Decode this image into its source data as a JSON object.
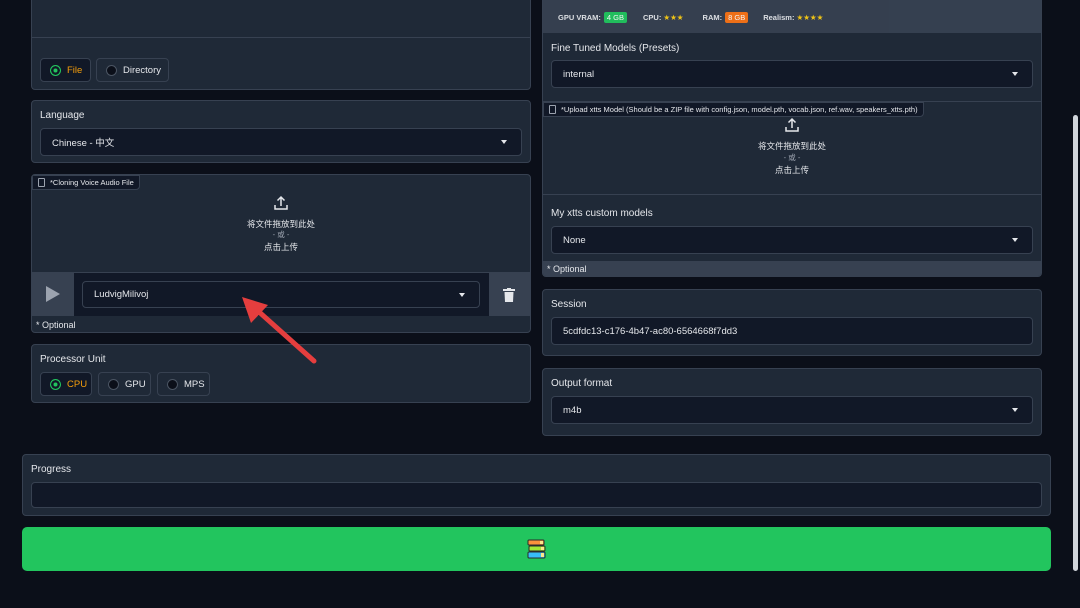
{
  "left": {
    "input_type": {
      "options": [
        "File",
        "Directory"
      ],
      "selected": "File"
    },
    "language": {
      "label": "Language",
      "value": "Chinese - 中文"
    },
    "voice_upload": {
      "tag": "*Cloning Voice Audio File",
      "drop_text": "将文件拖放到此处",
      "or_text": "- 或 -",
      "click_text": "点击上传"
    },
    "voice_select": {
      "value": "LudvigMilivoj",
      "optional": "* Optional"
    },
    "processor": {
      "label": "Processor Unit",
      "options": [
        "CPU",
        "GPU",
        "MPS"
      ],
      "selected": "CPU"
    }
  },
  "right": {
    "info_bar": {
      "gpu_label": "GPU VRAM:",
      "gpu_badge": "4 GB",
      "cpu_label": "CPU:",
      "cpu_stars": "★★★",
      "ram_label": "RAM:",
      "ram_badge": "8 GB",
      "realism_label": "Realism:",
      "realism_stars": "★★★★"
    },
    "fine_tuned": {
      "label": "Fine Tuned Models (Presets)",
      "value": "internal"
    },
    "xtts_upload": {
      "tag": "*Upload xtts Model (Should be a ZIP file with config.json, model.pth, vocab.json, ref.wav, speakers_xtts.pth)",
      "drop_text": "将文件拖放到此处",
      "or_text": "- 或 -",
      "click_text": "点击上传"
    },
    "custom_models": {
      "label": "My xtts custom models",
      "value": "None",
      "optional": "* Optional"
    },
    "session": {
      "label": "Session",
      "value": "5cdfdc13-c176-4b47-ac80-6564668f7dd3"
    },
    "output_format": {
      "label": "Output format",
      "value": "m4b"
    }
  },
  "progress": {
    "label": "Progress",
    "value": ""
  },
  "convert_button": {
    "icon": "books-icon"
  },
  "colors": {
    "background": "#0b0f19",
    "panel": "#1f2937",
    "accent_orange": "#f59e0b",
    "selected_green": "#22c55e",
    "button_green": "#22c55e",
    "badge_green": "#22c55e",
    "badge_orange": "#f97316",
    "arrow_red": "#e53e3e"
  }
}
